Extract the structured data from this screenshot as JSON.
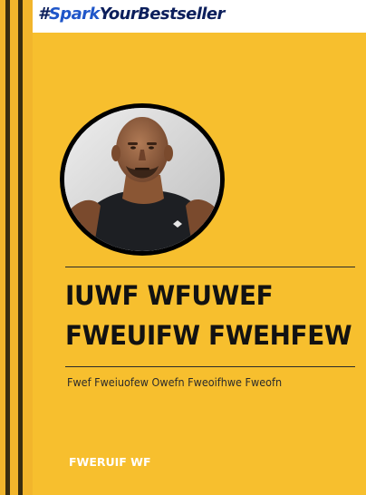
{
  "banner": {
    "hash": "#",
    "spark": "Spark",
    "rest": "YourBestseller"
  },
  "cover": {
    "title_line1": "IUWF WFUWEF",
    "title_line2": "FWEUIFW FWEHFEW",
    "subtitle": "Fwef Fweiuofew Owefn Fweoifhwe Fweofn",
    "author": "FWERUIF WF"
  },
  "colors": {
    "cover_background": "#f7bf2e",
    "spine": "#f2b52c",
    "banner_dark": "#0c1f5c",
    "banner_accent": "#1f56c9",
    "title_text": "#121212",
    "author_text": "#ffffff"
  }
}
